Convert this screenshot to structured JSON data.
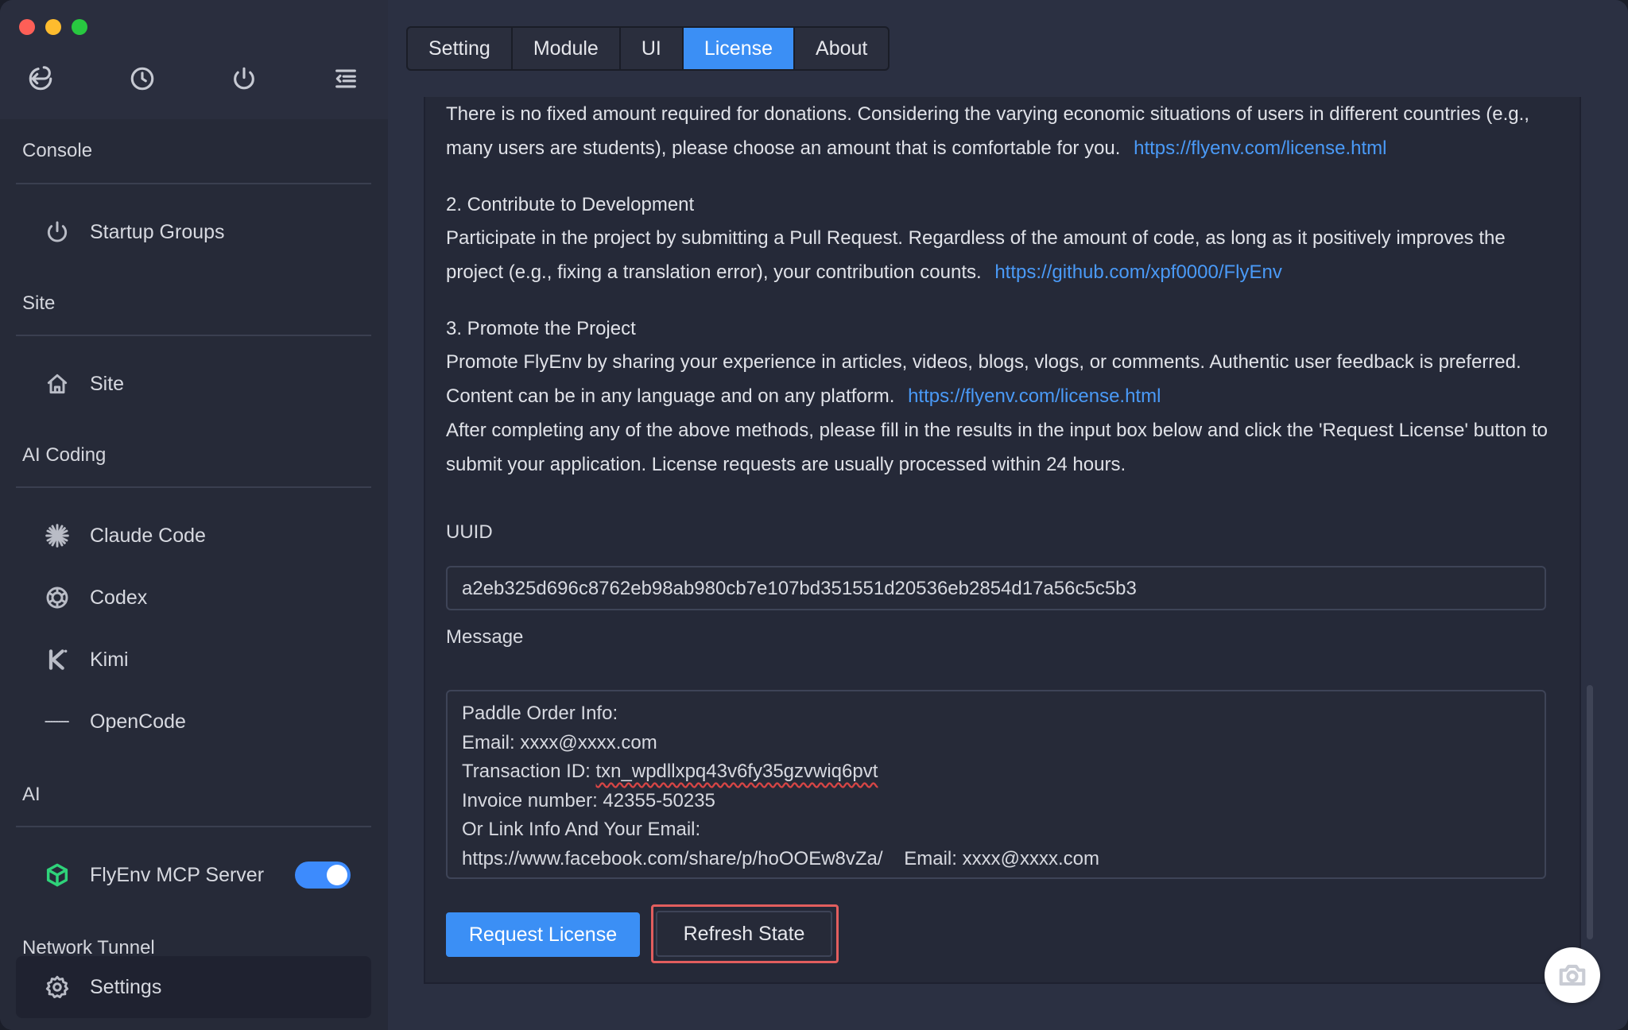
{
  "sidebar": {
    "top_icons": [
      "back-icon",
      "clock-icon",
      "power-icon",
      "menu-collapse-icon"
    ],
    "sections": {
      "console": "Console",
      "site": "Site",
      "ai_coding": "AI Coding",
      "ai": "AI",
      "network_tunnel": "Network Tunnel"
    },
    "items": {
      "startup_groups": "Startup Groups",
      "site": "Site",
      "claude_code": "Claude Code",
      "codex": "Codex",
      "kimi": "Kimi",
      "opencode": "OpenCode",
      "flyenv_mcp": "FlyEnv MCP Server",
      "settings": "Settings"
    },
    "mcp_toggle_on": true,
    "colors": {
      "toggle": "#3d8bfd",
      "mcp_icon": "#2fd37a"
    }
  },
  "tabs": [
    "Setting",
    "Module",
    "UI",
    "License",
    "About"
  ],
  "active_tab": "License",
  "license": {
    "p1": "There is no fixed amount required for donations. Considering the varying economic situations of users in different countries (e.g., many users are students), please choose an amount that is comfortable for you.",
    "p1_link": "https://flyenv.com/license.html",
    "h2": "2. Contribute to Development",
    "p2": "Participate in the project by submitting a Pull Request. Regardless of the amount of code, as long as it positively improves the project (e.g., fixing a translation error), your contribution counts.",
    "p2_link": "https://github.com/xpf0000/FlyEnv",
    "h3": "3. Promote the Project",
    "p3": "Promote FlyEnv by sharing your experience in articles, videos, blogs, vlogs, or comments. Authentic user feedback is preferred. Content can be in any language and on any platform.",
    "p3_link": "https://flyenv.com/license.html",
    "p4": "After completing any of the above methods, please fill in the results in the input box below and click the 'Request License' button to submit your application. License requests are usually processed within 24 hours.",
    "uuid_label": "UUID",
    "uuid_value": "a2eb325d696c8762eb98ab980cb7e107bd351551d20536eb2854d17a56c5c5b3",
    "message_label": "Message",
    "message_lines": {
      "l1": "Paddle Order Info:",
      "l2": "Email: xxxx@xxxx.com",
      "l3_prefix": "Transaction ID: ",
      "l3_tx": "txn_wpdllxpq43v6fy35gzvwiq6pvt",
      "l4": "Invoice number: 42355-50235",
      "l5": "Or Link Info And Your Email:",
      "l6": "https://www.facebook.com/share/p/hoOOEw8vZa/    Email: xxxx@xxxx.com"
    },
    "request_button": "Request License",
    "refresh_button": "Refresh State"
  },
  "colors": {
    "accent": "#3b8ff5",
    "link": "#4a9af7",
    "highlight": "#e25e5e"
  }
}
